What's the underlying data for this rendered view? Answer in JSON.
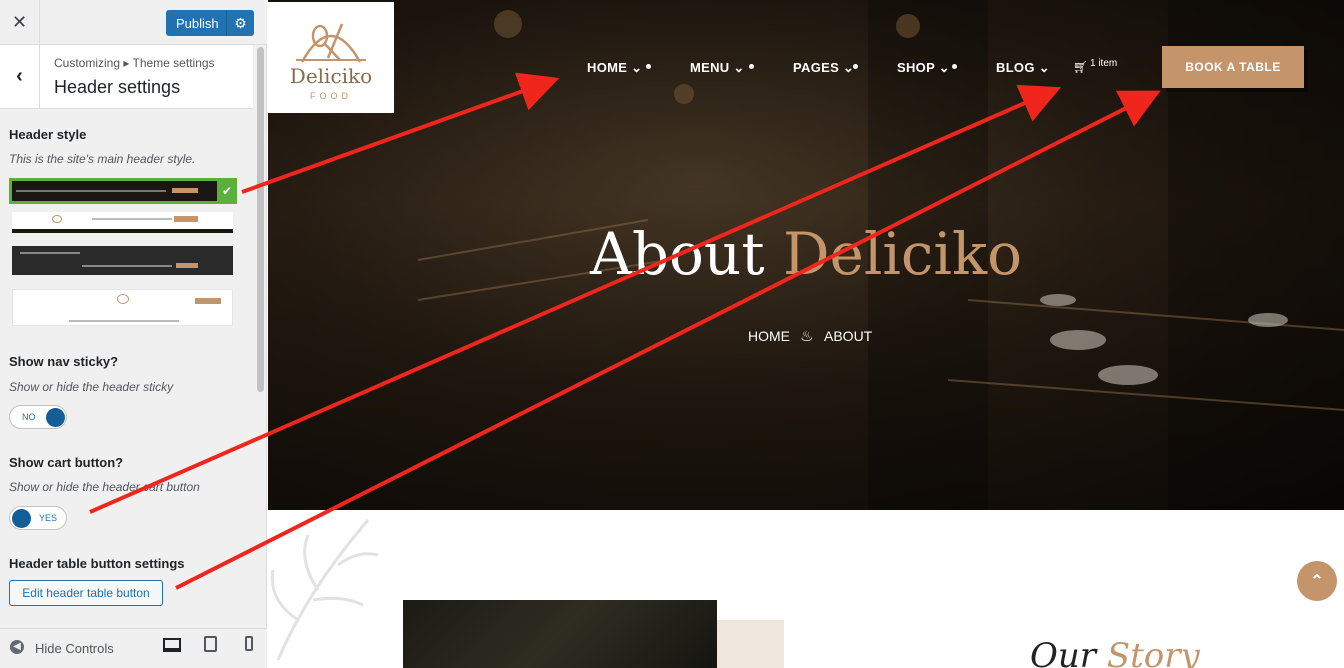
{
  "customizer": {
    "publish_label": "Publish",
    "breadcrumb": "Customizing ▸ Theme settings",
    "section_title": "Header settings",
    "header_style": {
      "label": "Header style",
      "description": "This is the site's main header style.",
      "selected_index": 0,
      "options": [
        "header-style-1",
        "header-style-2",
        "header-style-3",
        "header-style-4"
      ]
    },
    "nav_sticky": {
      "label": "Show nav sticky?",
      "description": "Show or hide the header sticky",
      "value": "NO"
    },
    "cart_button": {
      "label": "Show cart button?",
      "description": "Show or hide the header cart button",
      "value": "YES"
    },
    "table_button": {
      "label": "Header table button settings",
      "button_label": "Edit header table button"
    },
    "hide_controls_label": "Hide Controls",
    "device_icons": [
      "desktop-icon",
      "tablet-icon",
      "mobile-icon"
    ]
  },
  "site": {
    "logo_name": "Deliciko",
    "logo_tagline": "FOOD",
    "nav": [
      {
        "label": "HOME",
        "has_dropdown": true
      },
      {
        "label": "MENU",
        "has_dropdown": true
      },
      {
        "label": "PAGES",
        "has_dropdown": true
      },
      {
        "label": "SHOP",
        "has_dropdown": true
      },
      {
        "label": "BLOG",
        "has_dropdown": true
      }
    ],
    "cart_text": "1 item",
    "book_button": "BOOK A TABLE",
    "hero_title_main": "About",
    "hero_title_accent": "Deliciko",
    "breadcrumb_home": "HOME",
    "breadcrumb_current": "ABOUT",
    "story_title_main": "Our",
    "story_title_accent": "Story"
  },
  "colors": {
    "accent": "#c4956a",
    "wp_blue": "#2271b1",
    "arrow_red": "#f0261d",
    "selected_green": "#5bb03c"
  }
}
